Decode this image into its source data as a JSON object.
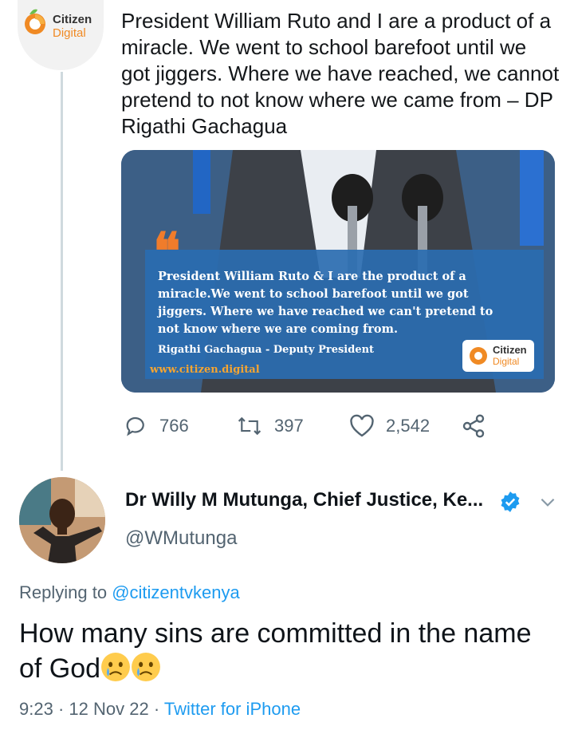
{
  "tweet": {
    "author_logo_text_1": "Citizen",
    "author_logo_text_2": "Digital",
    "text": "President William Ruto and I are a product of a miracle. We went to school barefoot until we got jiggers. Where we have reached, we cannot pretend to not know where we came from – DP Rigathi Gachagua",
    "media": {
      "quote_text": "President William Ruto & I are the product of a miracle.We went to school barefoot until we got jiggers. Where we have reached we can't pretend to not know where we are coming from.",
      "quote_author": "Rigathi Gachagua  - Deputy President",
      "url": "www.citizen.digital",
      "badge_1": "Citizen",
      "badge_2": "Digital"
    },
    "actions": {
      "replies": "766",
      "retweets": "397",
      "likes": "2,542"
    }
  },
  "reply": {
    "name": "Dr Willy M Mutunga, Chief Justice, Ke...",
    "handle": "@WMutunga",
    "replying_label": "Replying to",
    "replying_to": "@citizentvkenya",
    "text": "How many sins are committed in the name of God",
    "emoji": [
      "crying-face",
      "crying-face"
    ],
    "time": "9:23",
    "date": "12 Nov 22",
    "source": "Twitter for iPhone"
  },
  "colors": {
    "link": "#1d9bf0",
    "muted": "#536471",
    "verified": "#1d9bf0"
  }
}
